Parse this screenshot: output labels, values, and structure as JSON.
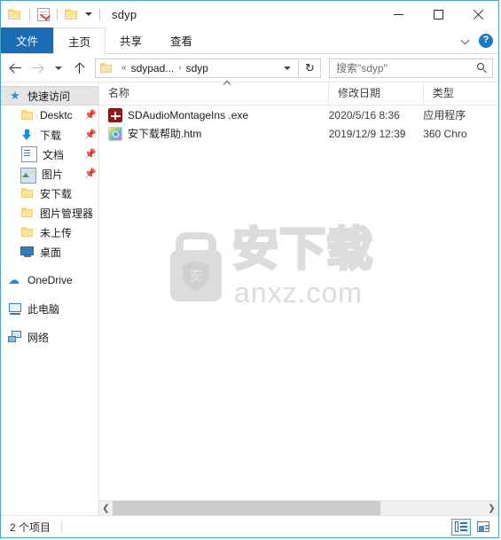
{
  "window": {
    "title": "sdyp",
    "quick_access_toolbar": [
      {
        "name": "folder-icon",
        "label": "新建文件夹"
      },
      {
        "name": "properties-icon",
        "label": "属性"
      },
      {
        "name": "folder-icon",
        "label": "文件夹"
      }
    ],
    "controls": {
      "minimize": "最小化",
      "maximize": "最大化",
      "close": "关闭"
    }
  },
  "ribbon": {
    "tabs": [
      {
        "label": "文件",
        "active": true
      },
      {
        "label": "主页",
        "active": false
      },
      {
        "label": "共享",
        "active": false
      },
      {
        "label": "查看",
        "active": false
      }
    ],
    "expand_label": "展开功能区",
    "help_label": "?"
  },
  "addressbar": {
    "back": "后退",
    "forward": "前进",
    "history": "最近浏览的位置",
    "up": "向上",
    "breadcrumb": {
      "overflow": "«",
      "items": [
        "sdypad...",
        "sdyp"
      ],
      "separator": "›"
    },
    "refresh": "↻"
  },
  "search": {
    "placeholder": "搜索\"sdyp\"",
    "icon": "search-icon"
  },
  "sidebar": {
    "items": [
      {
        "label": "快速访问",
        "icon": "star-icon",
        "selected": true,
        "indent": false,
        "pinned": false
      },
      {
        "label": "Desktc",
        "icon": "folder-icon",
        "selected": false,
        "indent": true,
        "pinned": true
      },
      {
        "label": "下载",
        "icon": "download-icon",
        "selected": false,
        "indent": true,
        "pinned": true
      },
      {
        "label": "文档",
        "icon": "document-icon",
        "selected": false,
        "indent": true,
        "pinned": true
      },
      {
        "label": "图片",
        "icon": "picture-icon",
        "selected": false,
        "indent": true,
        "pinned": true
      },
      {
        "label": "安下载",
        "icon": "folder-icon",
        "selected": false,
        "indent": true,
        "pinned": false
      },
      {
        "label": "图片管理器",
        "icon": "folder-icon",
        "selected": false,
        "indent": true,
        "pinned": false
      },
      {
        "label": "未上传",
        "icon": "folder-icon",
        "selected": false,
        "indent": true,
        "pinned": false
      },
      {
        "label": "桌面",
        "icon": "desktop-icon",
        "selected": false,
        "indent": true,
        "pinned": false
      },
      {
        "label": "OneDrive",
        "icon": "cloud-icon",
        "selected": false,
        "indent": false,
        "pinned": false
      },
      {
        "label": "此电脑",
        "icon": "pc-icon",
        "selected": false,
        "indent": false,
        "pinned": false
      },
      {
        "label": "网络",
        "icon": "network-icon",
        "selected": false,
        "indent": false,
        "pinned": false
      }
    ],
    "pin_glyph": "📌"
  },
  "filelist": {
    "columns": [
      {
        "label": "名称",
        "sorted": true,
        "sort_direction": "asc"
      },
      {
        "label": "修改日期",
        "sorted": false
      },
      {
        "label": "类型",
        "sorted": false
      }
    ],
    "rows": [
      {
        "name": "SDAudioMontageIns .exe",
        "date": "2020/5/16 8:36",
        "type": "应用程序",
        "icon": "exe-icon"
      },
      {
        "name": "安下载帮助.htm",
        "date": "2019/12/9 12:39",
        "type": "360 Chro",
        "icon": "html-icon"
      }
    ]
  },
  "watermark": {
    "text_cn": "安下载",
    "text_en": "anxz.com",
    "bag_letter": "安",
    "color": "#dcdcdc"
  },
  "scrollbar": {
    "left_arrow": "❮",
    "right_arrow": "❯"
  },
  "statusbar": {
    "item_count": "2 个项目",
    "views": [
      {
        "name": "details-view",
        "label": "详细信息",
        "selected": true
      },
      {
        "name": "large-icons-view",
        "label": "大图标",
        "selected": false
      }
    ]
  },
  "colors": {
    "accent": "#1c6bb5",
    "window_border": "#4ca0cd",
    "selection": "#e4e4e4"
  }
}
